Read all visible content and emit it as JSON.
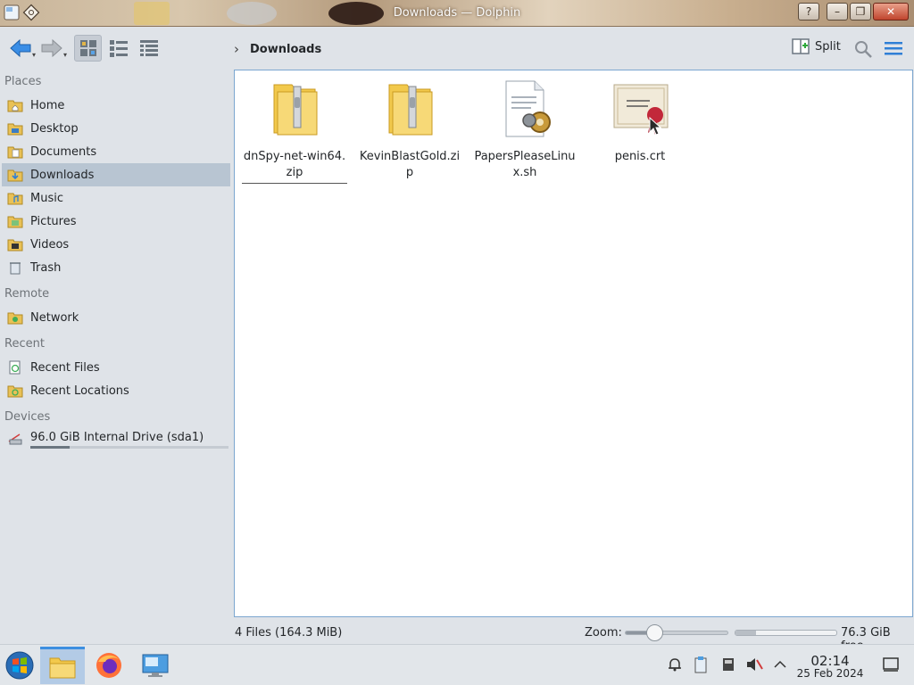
{
  "window": {
    "title": "Downloads — Dolphin",
    "controls": {
      "help": "?",
      "minimize": "–",
      "maximize": "❐",
      "close": "✕"
    }
  },
  "toolbar": {
    "back": "back-icon",
    "forward": "forward-icon",
    "views": [
      "icons-view",
      "compact-view",
      "details-view"
    ],
    "active_view": "icons-view",
    "breadcrumb": [
      "Downloads"
    ],
    "split_label": "Split",
    "search": "search-icon",
    "menu": "hamburger-menu-icon"
  },
  "sidebar": {
    "sections": {
      "places": "Places",
      "remote": "Remote",
      "recent": "Recent",
      "devices": "Devices"
    },
    "places": [
      {
        "label": "Home",
        "icon": "home-folder-icon"
      },
      {
        "label": "Desktop",
        "icon": "desktop-folder-icon"
      },
      {
        "label": "Documents",
        "icon": "documents-folder-icon"
      },
      {
        "label": "Downloads",
        "icon": "downloads-folder-icon",
        "selected": true
      },
      {
        "label": "Music",
        "icon": "music-folder-icon"
      },
      {
        "label": "Pictures",
        "icon": "pictures-folder-icon"
      },
      {
        "label": "Videos",
        "icon": "videos-folder-icon"
      },
      {
        "label": "Trash",
        "icon": "trash-icon"
      }
    ],
    "remote": [
      {
        "label": "Network",
        "icon": "network-folder-icon"
      }
    ],
    "recent": [
      {
        "label": "Recent Files",
        "icon": "recent-files-icon"
      },
      {
        "label": "Recent Locations",
        "icon": "recent-locations-icon"
      }
    ],
    "devices": [
      {
        "label": "96.0 GiB Internal Drive (sda1)",
        "icon": "drive-icon",
        "usage_fraction": 0.2
      }
    ]
  },
  "files": [
    {
      "name": "dnSpy-net-win64.zip",
      "type": "zip"
    },
    {
      "name": "KevinBlastGold.zip",
      "type": "zip"
    },
    {
      "name": "PapersPleaseLinux.sh",
      "type": "script"
    },
    {
      "name": "penis.crt",
      "type": "certificate"
    }
  ],
  "status": {
    "summary": "4 Files (164.3 MiB)",
    "zoom_label": "Zoom:",
    "zoom_fraction": 0.28,
    "free_space": "76.3 GiB free",
    "used_fraction": 0.2
  },
  "taskbar": {
    "apps": [
      "start-menu",
      "dolphin-file-manager",
      "firefox",
      "system-settings"
    ],
    "active_app": "dolphin-file-manager",
    "tray": [
      "notifications-icon",
      "clipboard-icon",
      "storage-icon",
      "volume-muted-icon",
      "expand-tray-icon"
    ],
    "clock": {
      "time": "02:14",
      "date": "25 Feb 2024"
    },
    "show_desktop": "show-desktop-icon"
  },
  "colors": {
    "selection": "#b8c5d2",
    "view_border": "#7ba6cf",
    "folder_yellow": "#f2c94c",
    "accent_blue": "#3d8fe0"
  }
}
